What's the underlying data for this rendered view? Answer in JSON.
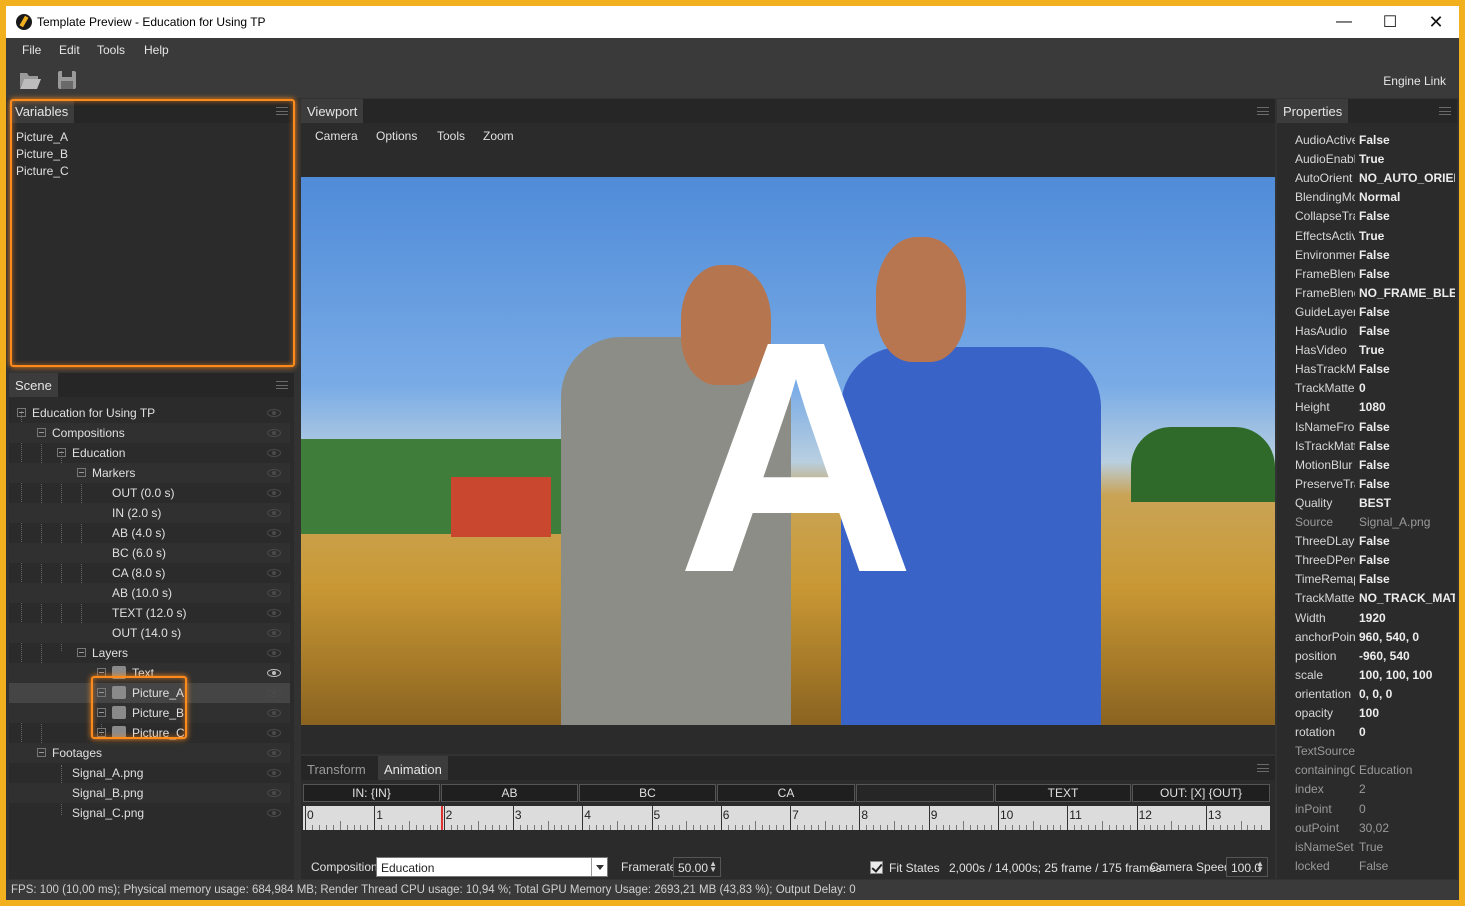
{
  "window": {
    "title": "Template Preview - Education for Using TP"
  },
  "menu": [
    "File",
    "Edit",
    "Tools",
    "Help"
  ],
  "toolbar": {
    "engine_link": "Engine Link"
  },
  "variables": {
    "title": "Variables",
    "items": [
      "Picture_A",
      "Picture_B",
      "Picture_C"
    ]
  },
  "scene": {
    "title": "Scene",
    "items": [
      "Education for Using TP",
      "Compositions",
      "Education",
      "Markers",
      "OUT (0.0 s)",
      "IN (2.0 s)",
      "AB (4.0 s)",
      "BC (6.0 s)",
      "CA (8.0 s)",
      "AB (10.0 s)",
      "TEXT (12.0 s)",
      "OUT (14.0 s)",
      "Layers",
      "Text",
      "Picture_A",
      "Picture_B",
      "Picture_C",
      "Footages",
      "Signal_A.png",
      "Signal_B.png",
      "Signal_C.png"
    ]
  },
  "viewport": {
    "title": "Viewport",
    "menu": [
      "Camera",
      "Options",
      "Tools",
      "Zoom"
    ],
    "overlay_letter": "A"
  },
  "animation": {
    "tabs": [
      "Transform",
      "Animation"
    ],
    "markers": [
      "IN: {IN}",
      "AB",
      "BC",
      "CA",
      "",
      "TEXT",
      "OUT: [X] {OUT}"
    ],
    "ruler_labels": [
      "0",
      "1",
      "2",
      "3",
      "4",
      "5",
      "6",
      "7",
      "8",
      "9",
      "10",
      "11",
      "12",
      "13"
    ],
    "composition_label": "Composition:",
    "composition_value": "Education",
    "framerate_label": "Framerate:",
    "framerate_value": "50.00",
    "fit_states_label": "Fit States",
    "fit_states_checked": true,
    "time_info": "2,000s / 14,000s; 25 frame / 175 frames",
    "camera_speed_label": "Camera Speed:",
    "camera_speed_value": "100.0"
  },
  "properties": {
    "title": "Properties",
    "rows": [
      {
        "name": "AudioActive",
        "value": "False"
      },
      {
        "name": "AudioEnabled",
        "value": "True"
      },
      {
        "name": "AutoOrient",
        "value": "NO_AUTO_ORIENT"
      },
      {
        "name": "BlendingMode",
        "value": "Normal"
      },
      {
        "name": "CollapseTransformation",
        "value": "False"
      },
      {
        "name": "EffectsActive",
        "value": "True"
      },
      {
        "name": "EnvironmentLayer",
        "value": "False"
      },
      {
        "name": "FrameBlending",
        "value": "False"
      },
      {
        "name": "FrameBlendingType",
        "value": "NO_FRAME_BLEND"
      },
      {
        "name": "GuideLayer",
        "value": "False"
      },
      {
        "name": "HasAudio",
        "value": "False"
      },
      {
        "name": "HasVideo",
        "value": "True"
      },
      {
        "name": "HasTrackMatte",
        "value": "False"
      },
      {
        "name": "TrackMatte",
        "value": "0"
      },
      {
        "name": "Height",
        "value": "1080"
      },
      {
        "name": "IsNameFromSource",
        "value": "False"
      },
      {
        "name": "IsTrackMatte",
        "value": "False"
      },
      {
        "name": "MotionBlur",
        "value": "False"
      },
      {
        "name": "PreserveTransparency",
        "value": "False"
      },
      {
        "name": "Quality",
        "value": "BEST"
      },
      {
        "name": "Source",
        "value": "Signal_A.png",
        "dim": true
      },
      {
        "name": "ThreeDLayer",
        "value": "False"
      },
      {
        "name": "ThreeDPerChar",
        "value": "False"
      },
      {
        "name": "TimeRemapEnabled",
        "value": "False"
      },
      {
        "name": "TrackMatteType",
        "value": "NO_TRACK_MATTE"
      },
      {
        "name": "Width",
        "value": "1920"
      },
      {
        "name": "anchorPoint",
        "value": "960, 540, 0"
      },
      {
        "name": "position",
        "value": "-960, 540"
      },
      {
        "name": "scale",
        "value": "100, 100, 100"
      },
      {
        "name": "orientation",
        "value": "0, 0, 0"
      },
      {
        "name": "opacity",
        "value": "100"
      },
      {
        "name": "rotation",
        "value": "0"
      },
      {
        "name": "TextSource",
        "value": "",
        "dim": true
      },
      {
        "name": "containingComp",
        "value": "Education",
        "dim": true
      },
      {
        "name": "index",
        "value": "2",
        "dim": true
      },
      {
        "name": "inPoint",
        "value": "0",
        "dim": true
      },
      {
        "name": "outPoint",
        "value": "30,02",
        "dim": true
      },
      {
        "name": "isNameSet",
        "value": "True",
        "dim": true
      },
      {
        "name": "locked",
        "value": "False",
        "dim": true
      }
    ]
  },
  "status": "FPS: 100 (10,00 ms); Physical memory usage: 684,984 MB; Render Thread CPU usage: 10,94 %; Total GPU Memory Usage: 2693,21 MB (43,83 %); Output Delay: 0"
}
